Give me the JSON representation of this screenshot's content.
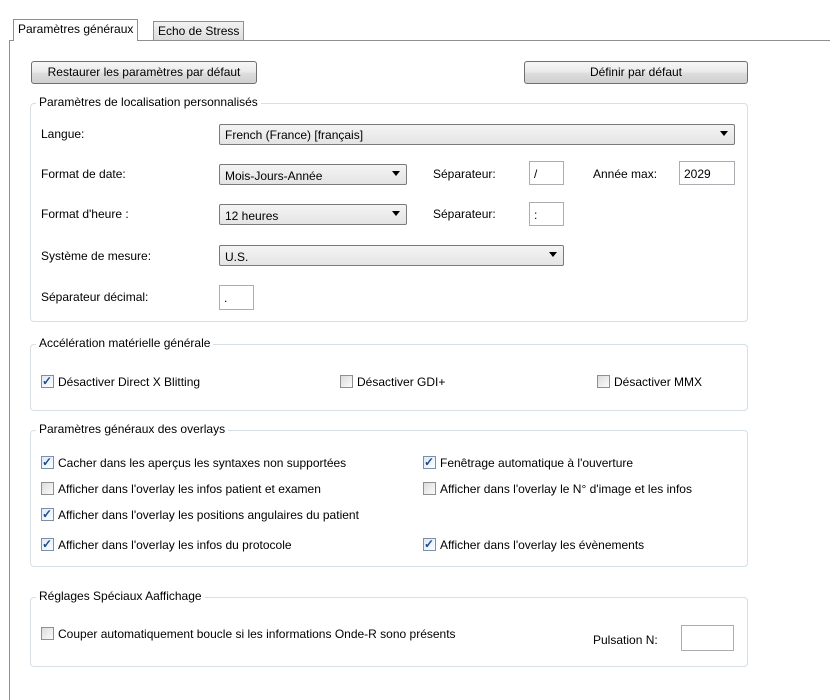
{
  "tabs": [
    {
      "label": "Paramètres généraux",
      "active": true
    },
    {
      "label": "Echo de Stress",
      "active": false
    }
  ],
  "buttons": {
    "restore": "Restaurer les paramètres par défaut",
    "set_default": "Définir par défaut"
  },
  "localization": {
    "legend": "Paramètres de localisation personnalisés",
    "language_label": "Langue:",
    "language_value": "French (France)    [français]",
    "date_format_label": "Format de date:",
    "date_format_value": "Mois-Jours-Année",
    "date_separator_label": "Séparateur:",
    "date_separator_value": "/",
    "max_year_label": "Année max:",
    "max_year_value": "2029",
    "time_format_label": "Format d'heure :",
    "time_format_value": "12 heures",
    "time_separator_label": "Séparateur:",
    "time_separator_value": ":",
    "measure_label": "Système de mesure:",
    "measure_value": "U.S.",
    "decimal_label": "Séparateur décimal:",
    "decimal_value": "."
  },
  "acceleration": {
    "legend": "Accélération matérielle générale",
    "items": [
      {
        "label": "Désactiver Direct X Blitting",
        "checked": true
      },
      {
        "label": "Désactiver GDI+",
        "checked": false
      },
      {
        "label": "Désactiver MMX",
        "checked": false
      }
    ]
  },
  "overlays": {
    "legend": "Paramètres généraux des overlays",
    "items": [
      {
        "label": "Cacher dans les aperçus les syntaxes non supportées",
        "checked": true
      },
      {
        "label": "Fenêtrage automatique à l'ouverture",
        "checked": true
      },
      {
        "label": "Afficher dans l'overlay les infos patient et examen",
        "checked": false
      },
      {
        "label": "Afficher dans l'overlay le N° d'image et les infos",
        "checked": false
      },
      {
        "label": "Afficher dans l'overlay les positions angulaires du patient",
        "checked": true
      },
      {
        "label": "Afficher dans l'overlay les infos du protocole",
        "checked": true
      },
      {
        "label": "Afficher dans l'overlay les évènements",
        "checked": true
      }
    ]
  },
  "special": {
    "legend": "Réglages Spéciaux Aaffichage",
    "cut_loop_label": "Couper automatiquement boucle si les informations Onde-R sono présents",
    "cut_loop_checked": false,
    "pulse_label": "Pulsation N:",
    "pulse_value": ""
  },
  "icons": {
    "checkbox_checked": "check-mark",
    "combo_arrow": "chevron-down-icon"
  }
}
